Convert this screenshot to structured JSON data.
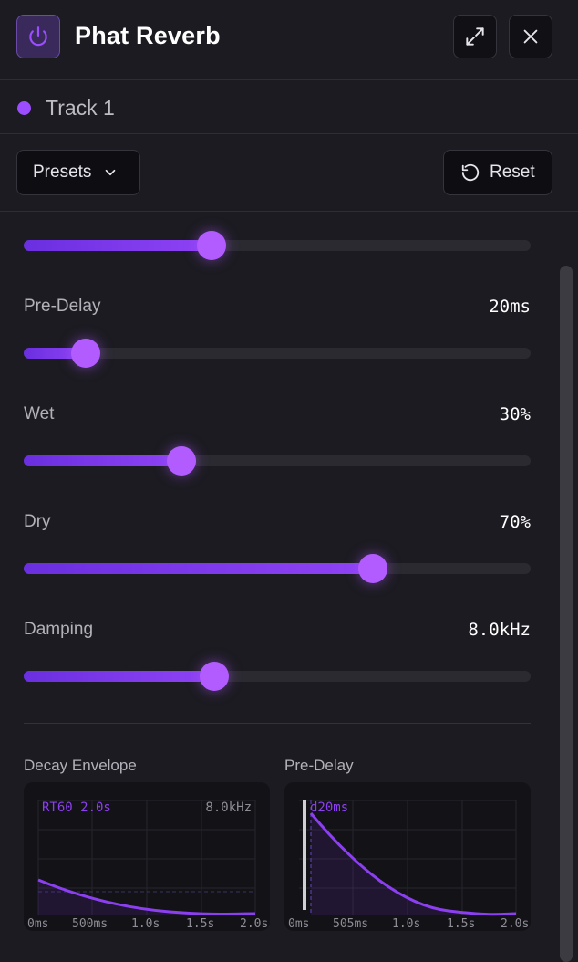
{
  "header": {
    "title": "Phat Reverb"
  },
  "track": {
    "name": "Track 1",
    "color": "#9b4dff"
  },
  "toolbar": {
    "presets_label": "Presets",
    "reset_label": "Reset"
  },
  "params": [
    {
      "label": "",
      "value": "",
      "fraction": 0.371
    },
    {
      "label": "Pre-Delay",
      "value": "20ms",
      "fraction": 0.122
    },
    {
      "label": "Wet",
      "value": "30%",
      "fraction": 0.311
    },
    {
      "label": "Dry",
      "value": "70%",
      "fraction": 0.689
    },
    {
      "label": "Damping",
      "value": "8.0kHz",
      "fraction": 0.376
    }
  ],
  "viz": {
    "decay": {
      "title": "Decay Envelope",
      "rt60": "RT60 2.0s",
      "freq": "8.0kHz",
      "ticks": [
        "0ms",
        "500ms",
        "1.0s",
        "1.5s",
        "2.0s"
      ]
    },
    "predelay": {
      "title": "Pre-Delay",
      "readout": "d20ms",
      "ticks": [
        "0ms",
        "505ms",
        "1.0s",
        "1.5s",
        "2.0s"
      ]
    }
  },
  "colors": {
    "accent": "#9b4dff",
    "thumb": "#b25cff",
    "background": "#1c1b21"
  },
  "icons": {
    "power": "power-icon",
    "expand": "expand-icon",
    "close": "close-icon",
    "chevron": "chevron-down-icon",
    "reset": "reset-icon"
  }
}
